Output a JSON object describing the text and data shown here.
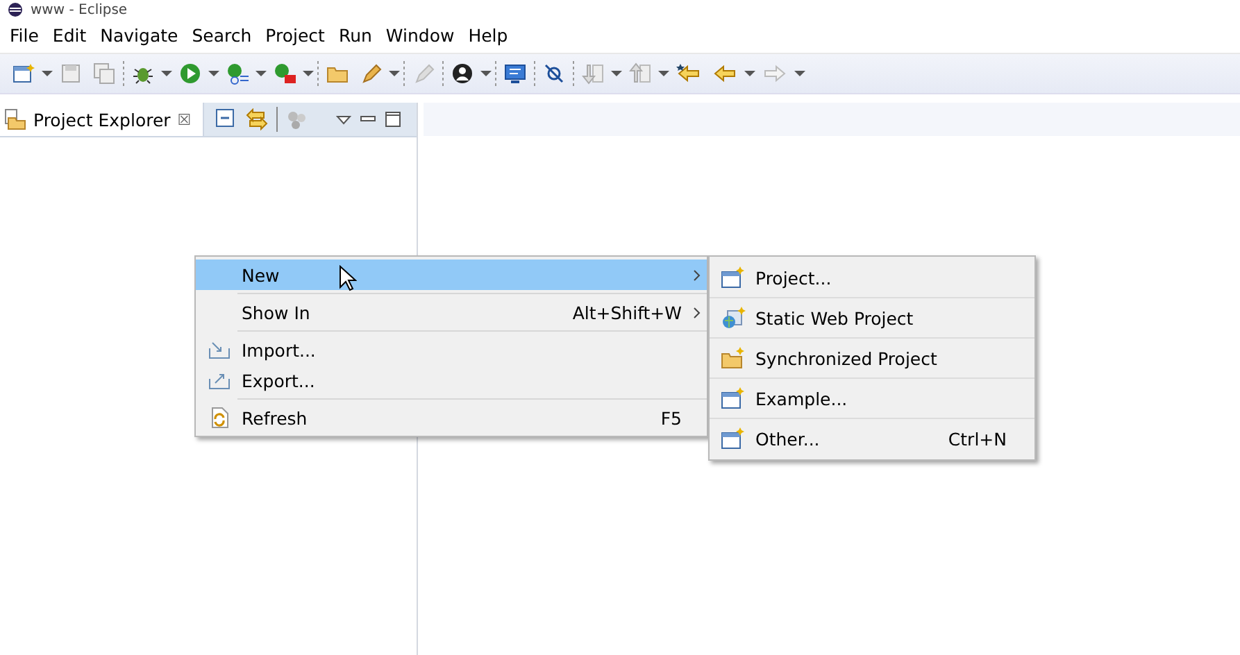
{
  "window": {
    "title": "www - Eclipse"
  },
  "menu_bar": [
    {
      "label": "File"
    },
    {
      "label": "Edit"
    },
    {
      "label": "Navigate"
    },
    {
      "label": "Search"
    },
    {
      "label": "Project"
    },
    {
      "label": "Run"
    },
    {
      "label": "Window"
    },
    {
      "label": "Help"
    }
  ],
  "project_explorer": {
    "title": "Project Explorer",
    "close": "☒"
  },
  "context_menu": {
    "groups": [
      [
        {
          "kind": "plain",
          "label": "New",
          "has_submenu": true,
          "selected": true
        }
      ],
      [
        {
          "kind": "plain",
          "label": "Show In",
          "shortcut": "Alt+Shift+W",
          "has_submenu": true,
          "selected": false
        }
      ],
      [
        {
          "kind": "import",
          "label": "Import...",
          "has_submenu": false,
          "selected": false
        },
        {
          "kind": "export",
          "label": "Export...",
          "has_submenu": false,
          "selected": false
        }
      ],
      [
        {
          "kind": "refresh",
          "label": "Refresh",
          "shortcut": "F5",
          "has_submenu": false,
          "selected": false
        }
      ]
    ]
  },
  "submenu": {
    "items": [
      {
        "kind": "project",
        "label": "Project..."
      },
      {
        "kind": "web",
        "label": "Static Web Project"
      },
      {
        "kind": "folder",
        "label": "Synchronized Project"
      },
      {
        "kind": "project",
        "label": "Example..."
      },
      {
        "kind": "project",
        "label": "Other...",
        "shortcut": "Ctrl+N"
      }
    ]
  }
}
